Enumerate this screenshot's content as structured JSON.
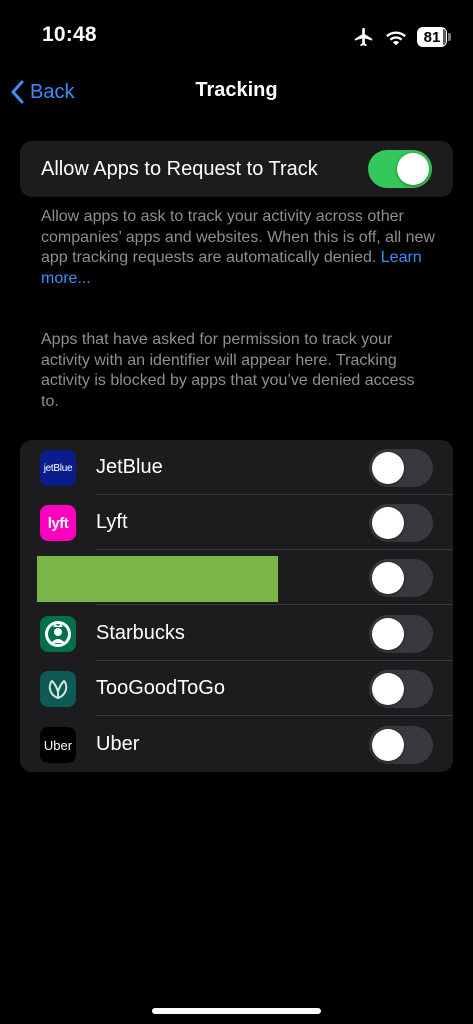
{
  "status": {
    "time": "10:48",
    "battery": "81",
    "icons": [
      "airplane-icon",
      "wifi-icon",
      "battery-icon"
    ]
  },
  "nav": {
    "back_label": "Back",
    "title": "Tracking"
  },
  "allow": {
    "label": "Allow Apps to Request to Track",
    "enabled": true
  },
  "description_1": "Allow apps to ask to track your activity across other companies’ apps and websites. When this is off, all new app tracking requests are automatically denied.",
  "learn_more": "Learn more...",
  "description_2": "Apps that have asked for permission to track your activity with an identifier will appear here. Tracking activity is blocked by apps that you’ve denied access to.",
  "apps": [
    {
      "name": "JetBlue",
      "icon_text": "jetBlue",
      "enabled": false
    },
    {
      "name": "Lyft",
      "icon_text": "lyft",
      "enabled": false
    },
    {
      "name": "",
      "redacted": true,
      "enabled": false
    },
    {
      "name": "Starbucks",
      "icon": "starbucks-siren-icon",
      "enabled": false
    },
    {
      "name": "TooGoodToGo",
      "icon": "toogoodtogo-leaf-icon",
      "enabled": false
    },
    {
      "name": "Uber",
      "icon_text": "Uber",
      "enabled": false
    }
  ],
  "colors": {
    "accent": "#3a8ff7",
    "toggle_on": "#34c759",
    "redaction": "#7ab648"
  }
}
